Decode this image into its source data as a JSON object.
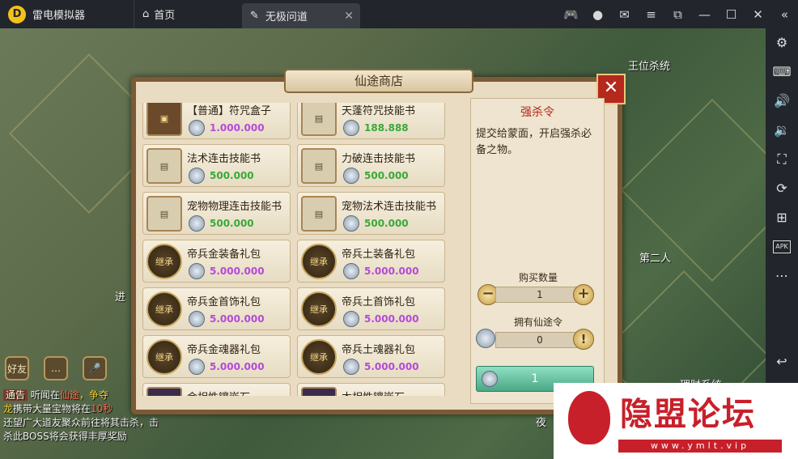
{
  "titlebar": {
    "app_name": "雷电模拟器",
    "home_tab": "首页",
    "game_tab": "无极问道"
  },
  "game": {
    "label_top_right": "王位杀统",
    "label_mid_left": "进",
    "label_lord": "第二人",
    "label_finance": "理财系统",
    "label_night": "夜",
    "hud_friend": "好友",
    "chat": {
      "tag": "通告",
      "line1_a": "听闻在",
      "line1_b": "仙途",
      "line1_c": "，争夺",
      "line2_a": "龙",
      "line2_b": "携带大量宝物将在",
      "line2_c": "10秒",
      "line3": "还望广大道友聚众前往将其击杀，击",
      "line4": "杀此BOSS将会获得丰厚奖励"
    }
  },
  "shop": {
    "title": "仙途商店",
    "items": [
      {
        "name": "【普通】符咒盒子",
        "price": "1.000.000",
        "price_color": "#b44ad8",
        "icon": "chest"
      },
      {
        "name": "天蓬符咒技能书",
        "price": "188.888",
        "price_color": "#3aa83a",
        "icon": "book"
      },
      {
        "name": "法术连击技能书",
        "price": "500.000",
        "price_color": "#3aa83a",
        "icon": "book"
      },
      {
        "name": "力破连击技能书",
        "price": "500.000",
        "price_color": "#3aa83a",
        "icon": "book"
      },
      {
        "name": "宠物物理连击技能书",
        "price": "500.000",
        "price_color": "#3aa83a",
        "icon": "book"
      },
      {
        "name": "宠物法术连击技能书",
        "price": "500.000",
        "price_color": "#3aa83a",
        "icon": "book"
      },
      {
        "name": "帝兵金装备礼包",
        "price": "5.000.000",
        "price_color": "#b44ad8",
        "icon": "gift"
      },
      {
        "name": "帝兵土装备礼包",
        "price": "5.000.000",
        "price_color": "#b44ad8",
        "icon": "gift"
      },
      {
        "name": "帝兵金首饰礼包",
        "price": "5.000.000",
        "price_color": "#b44ad8",
        "icon": "gift"
      },
      {
        "name": "帝兵土首饰礼包",
        "price": "5.000.000",
        "price_color": "#b44ad8",
        "icon": "gift"
      },
      {
        "name": "帝兵金魂器礼包",
        "price": "5.000.000",
        "price_color": "#b44ad8",
        "icon": "gift"
      },
      {
        "name": "帝兵土魂器礼包",
        "price": "5.000.000",
        "price_color": "#b44ad8",
        "icon": "gift"
      },
      {
        "name": "金相性镶嵌石",
        "price": "",
        "price_color": "#b44ad8",
        "icon": "gem"
      },
      {
        "name": "木相性镶嵌石",
        "price": "",
        "price_color": "#b44ad8",
        "icon": "gem"
      }
    ],
    "gift_icon_text": "继承",
    "detail": {
      "name": "强杀令",
      "description": "提交给蒙面，开启强杀必备之物。",
      "qty_label": "购买数量",
      "qty_value": "1",
      "own_label": "拥有仙途令",
      "own_value": "0",
      "buy_label": "1"
    }
  },
  "watermark": {
    "text": "隐盟论坛",
    "url": "www.ymlt.vip"
  }
}
